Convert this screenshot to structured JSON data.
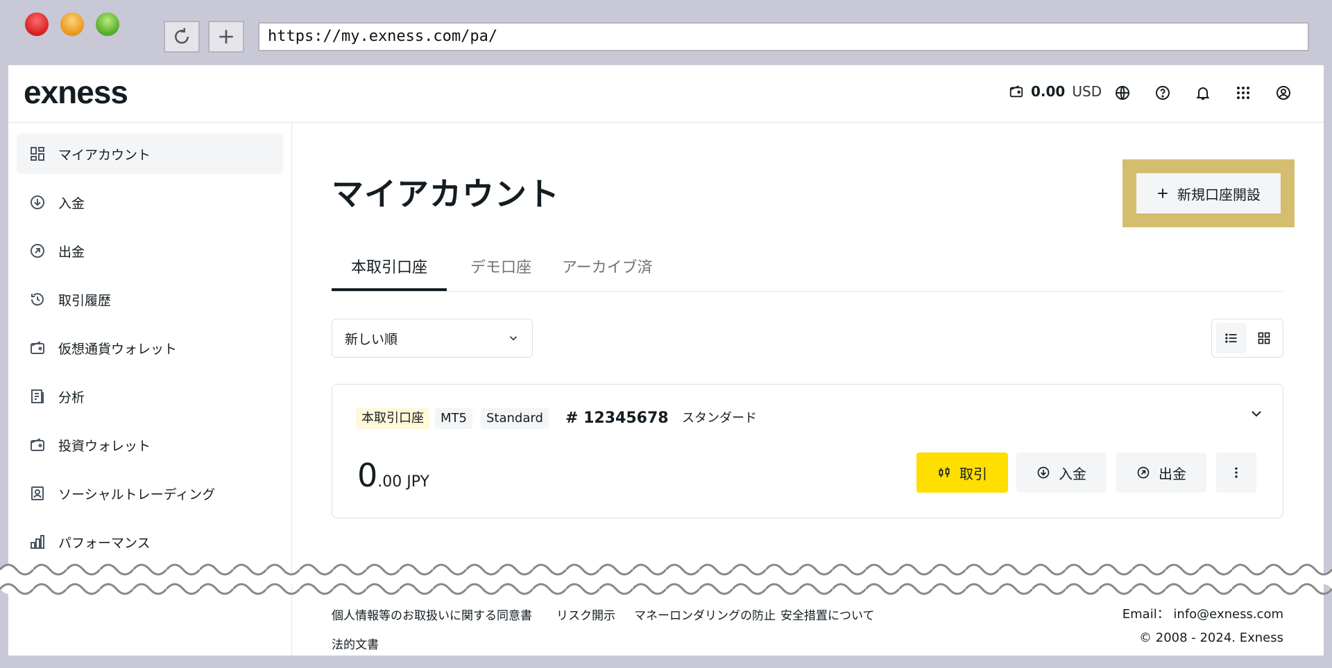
{
  "browser": {
    "url": "https://my.exness.com/pa/"
  },
  "header": {
    "logo": "exness",
    "balance_amount": "0.00",
    "balance_currency": "USD"
  },
  "sidebar": {
    "items": [
      {
        "label": "マイアカウント",
        "icon": "dashboard-icon",
        "active": true
      },
      {
        "label": "入金",
        "icon": "deposit-icon"
      },
      {
        "label": "出金",
        "icon": "withdraw-icon"
      },
      {
        "label": "取引履歴",
        "icon": "history-icon"
      },
      {
        "label": "仮想通貨ウォレット",
        "icon": "wallet-icon"
      },
      {
        "label": "分析",
        "icon": "analytics-icon"
      },
      {
        "label": "投資ウォレット",
        "icon": "wallet-icon"
      },
      {
        "label": "ソーシャルトレーディング",
        "icon": "social-trading-icon"
      },
      {
        "label": "パフォーマンス",
        "icon": "performance-icon"
      }
    ]
  },
  "main": {
    "title": "マイアカウント",
    "new_account_label": "新規口座開設",
    "tabs": [
      {
        "label": "本取引口座",
        "active": true
      },
      {
        "label": "デモ口座"
      },
      {
        "label": "アーカイブ済"
      }
    ],
    "sort_label": "新しい順",
    "account": {
      "badges": [
        "本取引口座",
        "MT5",
        "Standard"
      ],
      "number": "# 12345678",
      "type": "スタンダード",
      "balance_int": "0",
      "balance_dec": ".00 JPY",
      "trade_label": "取引",
      "deposit_label": "入金",
      "withdraw_label": "出金"
    }
  },
  "footer": {
    "links": [
      "個人情報等のお取扱いに関する同意書",
      "リスク開示",
      "マネーロンダリングの防止",
      "安全措置について",
      "法的文書"
    ],
    "email": "Email： info@exness.com",
    "copyright": "© 2008 - 2024. Exness"
  },
  "colors": {
    "accent": "#ffde02",
    "highlight": "#d4bd6f"
  }
}
